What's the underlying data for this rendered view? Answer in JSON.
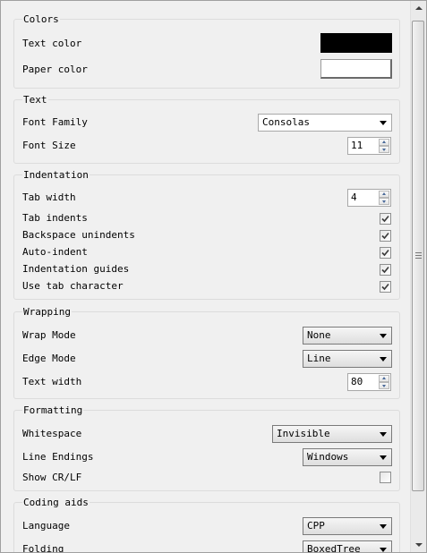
{
  "colors": {
    "title": "Colors",
    "text_color_label": "Text color",
    "text_color_value": "#000000",
    "paper_color_label": "Paper color",
    "paper_color_value": "#ffffff"
  },
  "text": {
    "title": "Text",
    "font_family_label": "Font Family",
    "font_family_value": "Consolas",
    "font_size_label": "Font Size",
    "font_size_value": "11"
  },
  "indentation": {
    "title": "Indentation",
    "tab_width_label": "Tab width",
    "tab_width_value": "4",
    "tab_indents_label": "Tab indents",
    "tab_indents_checked": true,
    "backspace_unindents_label": "Backspace unindents",
    "backspace_unindents_checked": true,
    "auto_indent_label": "Auto-indent",
    "auto_indent_checked": true,
    "indentation_guides_label": "Indentation guides",
    "indentation_guides_checked": true,
    "use_tab_character_label": "Use tab character",
    "use_tab_character_checked": true
  },
  "wrapping": {
    "title": "Wrapping",
    "wrap_mode_label": "Wrap Mode",
    "wrap_mode_value": "None",
    "edge_mode_label": "Edge Mode",
    "edge_mode_value": "Line",
    "text_width_label": "Text width",
    "text_width_value": "80"
  },
  "formatting": {
    "title": "Formatting",
    "whitespace_label": "Whitespace",
    "whitespace_value": "Invisible",
    "line_endings_label": "Line Endings",
    "line_endings_value": "Windows",
    "show_crlf_label": "Show CR/LF",
    "show_crlf_checked": false
  },
  "coding_aids": {
    "title": "Coding aids",
    "language_label": "Language",
    "language_value": "CPP",
    "folding_label": "Folding",
    "folding_value": "BoxedTree"
  }
}
